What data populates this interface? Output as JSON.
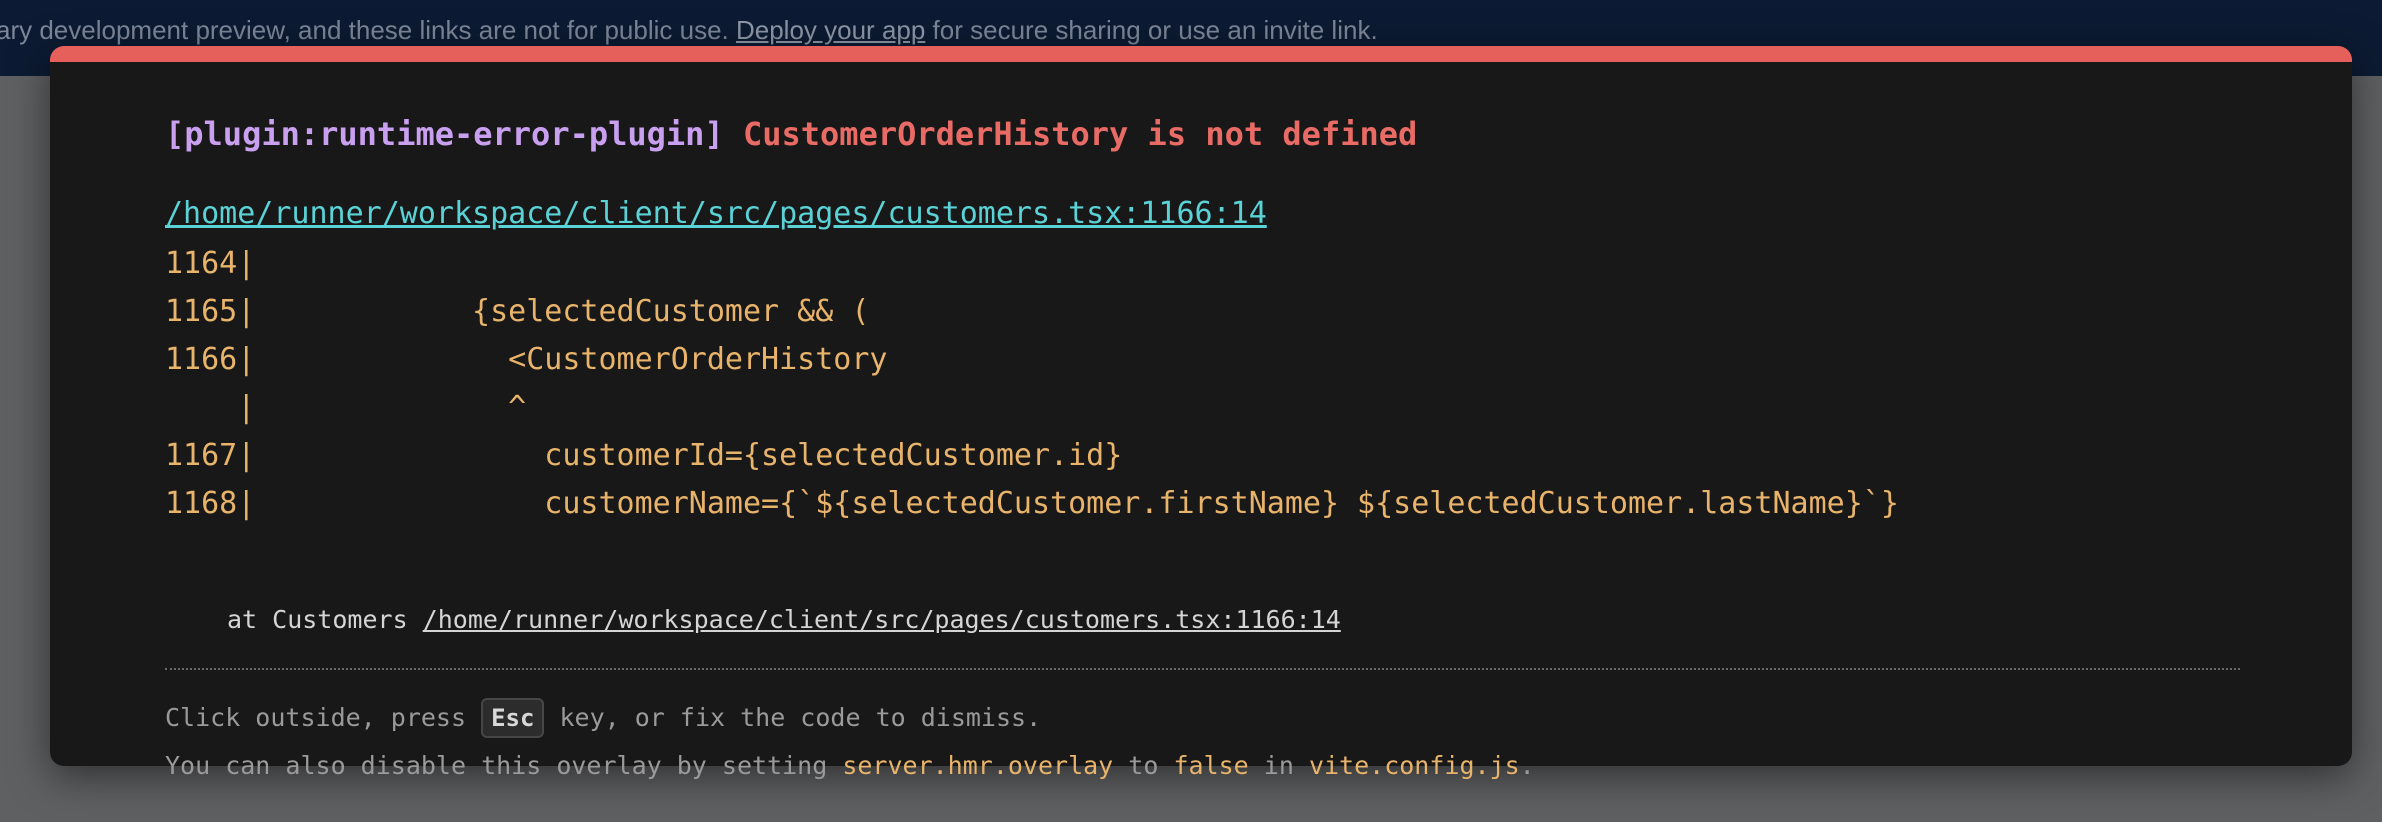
{
  "banner": {
    "text_before": "ary development preview, and these links are not for public use. ",
    "link": "Deploy your app",
    "text_after": " for secure sharing or use an invite link."
  },
  "error": {
    "plugin": "[plugin:runtime-error-plugin]",
    "message": "CustomerOrderHistory is not defined",
    "file": "/home/runner/workspace/client/src/pages/customers.tsx:1166:14",
    "frame": [
      "1164|",
      "1165|            {selectedCustomer && (",
      "1166|              <CustomerOrderHistory",
      "    |              ^",
      "1167|                customerId={selectedCustomer.id}",
      "1168|                customerName={`${selectedCustomer.firstName} ${selectedCustomer.lastName}`}"
    ],
    "stack_prefix": "at Customers ",
    "stack_link": "/home/runner/workspace/client/src/pages/customers.tsx:1166:14"
  },
  "tip": {
    "line1_before": "Click outside, press ",
    "key": "Esc",
    "line1_after": " key, or fix the code to dismiss.",
    "line2_a": "You can also disable this overlay by setting ",
    "line2_code1": "server.hmr.overlay",
    "line2_b": " to ",
    "line2_code2": "false",
    "line2_c": " in ",
    "line2_code3": "vite.config.js",
    "line2_d": "."
  },
  "colors": {
    "accent_red": "#e5605a",
    "plugin_purple": "#c9a0f0",
    "file_cyan": "#5ad2d6",
    "code_yellow": "#e8b36a"
  }
}
